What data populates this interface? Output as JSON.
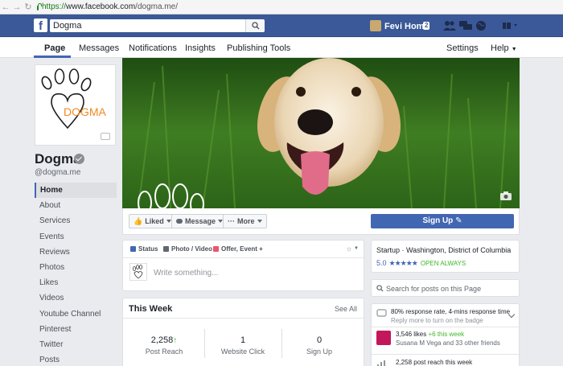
{
  "browser": {
    "url_scheme": "https://",
    "url_host": "www.facebook.com",
    "url_path": "/dogma.me/"
  },
  "fb_header": {
    "logo_letter": "f",
    "search_value": "Dogma",
    "user_name": "Fevi",
    "home_label": "Home",
    "home_count": "2"
  },
  "tabs": {
    "page": "Page",
    "messages": "Messages",
    "notifications": "Notifications",
    "insights": "Insights",
    "publishing_tools": "Publishing Tools",
    "settings": "Settings",
    "help": "Help"
  },
  "profile": {
    "name": "Dogma",
    "handle": "@dogma.me",
    "logo_text": "DOGMA"
  },
  "sidenav": [
    "Home",
    "About",
    "Services",
    "Events",
    "Reviews",
    "Photos",
    "Likes",
    "Videos",
    "Youtube Channel",
    "Pinterest",
    "Twitter",
    "Posts"
  ],
  "actions": {
    "liked": "Liked",
    "message": "Message",
    "more": "More",
    "signup": "Sign Up"
  },
  "composer": {
    "status": "Status",
    "photo_video": "Photo / Video",
    "offer_event": "Offer, Event +",
    "placeholder": "Write something..."
  },
  "this_week": {
    "title": "This Week",
    "see_all": "See All",
    "stats": [
      {
        "value": "2,258",
        "label": "Post Reach"
      },
      {
        "value": "1",
        "label": "Website Click"
      },
      {
        "value": "0",
        "label": "Sign Up"
      }
    ]
  },
  "about": {
    "category": "Startup · Washington, District of Columbia",
    "rating": "5.0",
    "stars": "★★★★★",
    "open": "OPEN ALWAYS"
  },
  "page_search": {
    "placeholder": "Search for posts on this Page"
  },
  "insights": {
    "response": "80% response rate, 4-mins response time",
    "response_hint": "Reply more to turn on the badge",
    "likes": "3,546 likes",
    "likes_new": "+6 this week",
    "likes_friends": "Susana M Vega and 33 other friends",
    "reach": "2,258 post reach this week"
  },
  "colors": {
    "fb_blue": "#3b5998",
    "accent": "#4267b2",
    "logo_orange": "#f08a24",
    "success": "#42b72a"
  }
}
